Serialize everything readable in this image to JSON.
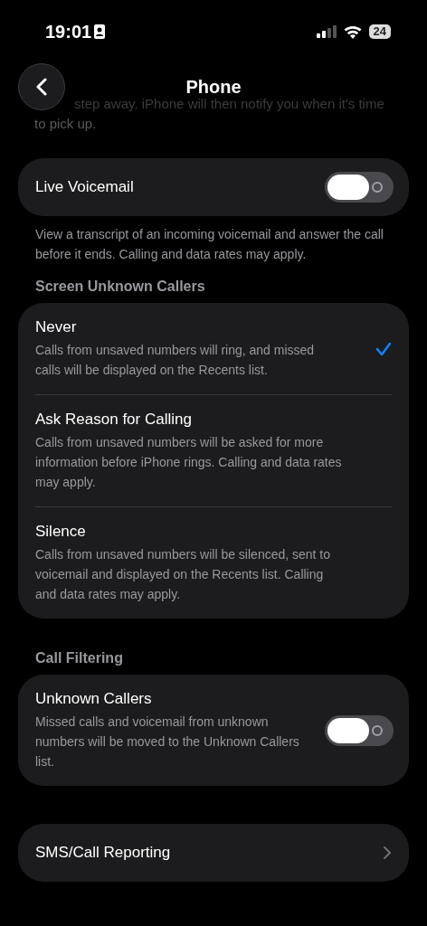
{
  "status_bar": {
    "time": "19:01",
    "battery": "24"
  },
  "nav": {
    "title": "Phone"
  },
  "prev_footer": [
    "step away. iPhone will then notify you when it's time",
    "to pick up."
  ],
  "live_voicemail": {
    "label": "Live Voicemail",
    "on": false,
    "footer": "View a transcript of an incoming voicemail and answer the call before it ends. Calling and data rates may apply."
  },
  "screen_unknown_callers": {
    "header": "Screen Unknown Callers",
    "options": [
      {
        "title": "Never",
        "description": "Calls from unsaved numbers will ring, and missed calls will be displayed on the Recents list.",
        "selected": true
      },
      {
        "title": "Ask Reason for Calling",
        "description": "Calls from unsaved numbers will be asked for more information before iPhone rings. Calling and data rates may apply.",
        "selected": false
      },
      {
        "title": "Silence",
        "description": "Calls from unsaved numbers will be silenced, sent to voicemail and displayed on the Recents list. Calling and data rates may apply.",
        "selected": false
      }
    ]
  },
  "call_filtering": {
    "header": "Call Filtering",
    "label": "Unknown Callers",
    "description": "Missed calls and voicemail from unknown numbers will be moved to the Unknown Callers list.",
    "on": false
  },
  "sms_call_reporting": {
    "label": "SMS/Call Reporting"
  }
}
